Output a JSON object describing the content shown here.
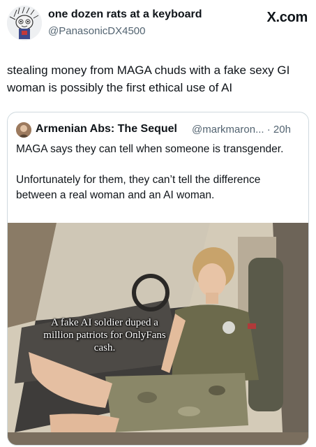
{
  "post": {
    "display_name": "one dozen rats at a keyboard",
    "handle": "@PanasonicDX4500",
    "site": "X.com",
    "text": "stealing money from MAGA chuds with a fake sexy GI woman is possibly the first ethical use of AI"
  },
  "quoted": {
    "display_name": "Armenian Abs: The Sequel",
    "handle_time": "@markmaron... · 20h",
    "paragraphs": [
      "MAGA says they can tell when someone is transgender.",
      "Unfortunately for them, they can’t tell the difference between a real woman and an AI woman."
    ],
    "image_caption": "A fake AI soldier duped a million patriots for OnlyFans cash."
  },
  "icons": {
    "avatar": "cartoon-rat-avatar-icon",
    "quoted_avatar": "user-avatar-icon"
  }
}
